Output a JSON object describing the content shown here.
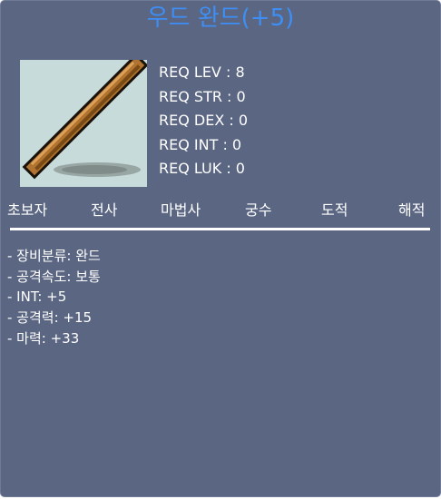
{
  "title": "우드 완드(+5)",
  "item_icon": "wooden-wand-icon",
  "requirements": [
    "REQ LEV : 8",
    "REQ STR : 0",
    "REQ DEX : 0",
    "REQ INT : 0",
    "REQ LUK : 0"
  ],
  "jobs": [
    "초보자",
    "전사",
    "마법사",
    "궁수",
    "도적",
    "해적"
  ],
  "stats": [
    "- 장비분류: 완드",
    "- 공격속도: 보통",
    "- INT: +5",
    "- 공격력: +15",
    "- 마력: +33"
  ],
  "colors": {
    "panel": "#5b6683",
    "title": "#3d8ff5",
    "text": "#ffffff",
    "icon_background": "#c7dbdb"
  }
}
